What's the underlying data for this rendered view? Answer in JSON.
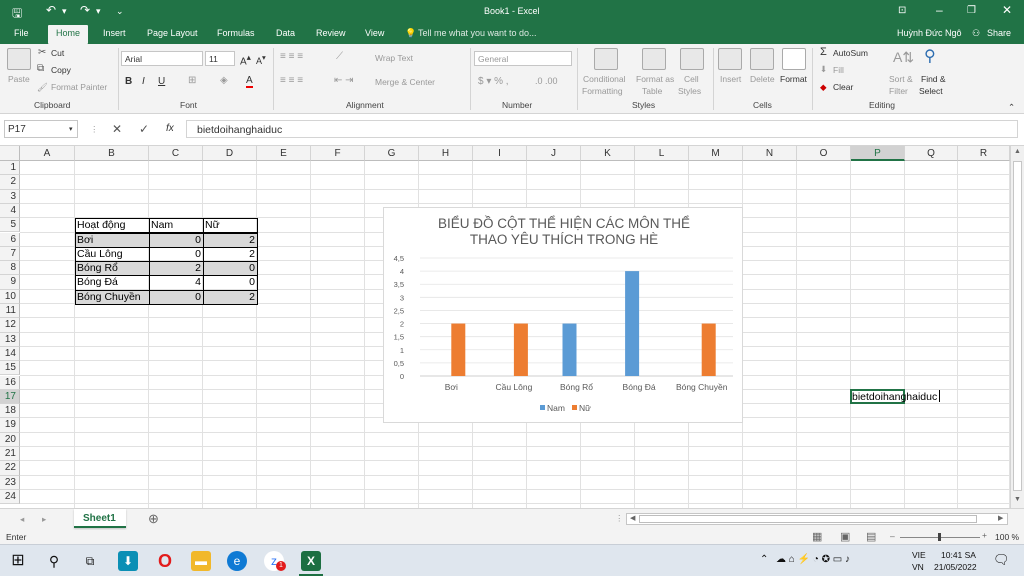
{
  "window": {
    "title": "Book1 - Excel",
    "user": "Huỳnh Đức Ngô",
    "share": "Share",
    "tell_me": "Tell me what you want to do..."
  },
  "menu": [
    "File",
    "Home",
    "Insert",
    "Page Layout",
    "Formulas",
    "Data",
    "Review",
    "View"
  ],
  "ribbon": {
    "clipboard": {
      "paste": "Paste",
      "cut": "Cut",
      "copy": "Copy",
      "format_painter": "Format Painter",
      "label": "Clipboard"
    },
    "font": {
      "name": "Arial",
      "size": "11",
      "bold": "B",
      "italic": "I",
      "underline": "U",
      "label": "Font"
    },
    "alignment": {
      "wrap": "Wrap Text",
      "merge": "Merge & Center",
      "label": "Alignment"
    },
    "number": {
      "format": "General",
      "label": "Number"
    },
    "styles": {
      "conditional1": "Conditional",
      "conditional2": "Formatting",
      "table1": "Format as",
      "table2": "Table",
      "cell1": "Cell",
      "cell2": "Styles",
      "label": "Styles"
    },
    "cells": {
      "insert": "Insert",
      "delete": "Delete",
      "format": "Format",
      "label": "Cells"
    },
    "editing": {
      "autosum": "AutoSum",
      "fill": "Fill",
      "clear": "Clear",
      "sort1": "Sort &",
      "sort2": "Filter",
      "find1": "Find &",
      "find2": "Select",
      "label": "Editing"
    }
  },
  "formula_bar": {
    "name_box": "P17",
    "fx": "fx",
    "value": "bietdoihanghaiduc"
  },
  "columns": [
    "A",
    "B",
    "C",
    "D",
    "E",
    "F",
    "G",
    "H",
    "I",
    "J",
    "K",
    "L",
    "M",
    "N",
    "O",
    "P",
    "Q",
    "R"
  ],
  "rows": [
    "1",
    "2",
    "3",
    "4",
    "5",
    "6",
    "7",
    "8",
    "9",
    "10",
    "11",
    "12",
    "13",
    "14",
    "15",
    "16",
    "17",
    "18",
    "19",
    "20",
    "21",
    "22",
    "23",
    "24"
  ],
  "table": {
    "headers": [
      "Hoạt động",
      "Nam",
      "Nữ"
    ],
    "rows": [
      [
        "Bơi",
        "0",
        "2"
      ],
      [
        "Cầu Lông",
        "0",
        "2"
      ],
      [
        "Bóng Rổ",
        "2",
        "0"
      ],
      [
        "Bóng Đá",
        "4",
        "0"
      ],
      [
        "Bóng Chuyền",
        "0",
        "2"
      ]
    ]
  },
  "active_cell_text": "bietdoihanghaiduc",
  "chart_data": {
    "type": "bar",
    "title_line1": "BIỂU ĐỒ CỘT THỂ HIỆN CÁC MÔN THỂ",
    "title_line2": "THAO YÊU THÍCH TRONG HÈ",
    "categories": [
      "Bơi",
      "Cầu Lông",
      "Bóng Rổ",
      "Bóng Đá",
      "Bóng Chuyền"
    ],
    "series": [
      {
        "name": "Nam",
        "values": [
          0,
          0,
          2,
          4,
          0
        ],
        "color": "#5b9bd5"
      },
      {
        "name": "Nữ",
        "values": [
          2,
          2,
          0,
          0,
          2
        ],
        "color": "#ed7d31"
      }
    ],
    "yticks": [
      "0",
      "0,5",
      "1",
      "1,5",
      "2",
      "2,5",
      "3",
      "3,5",
      "4",
      "4,5"
    ],
    "ylim": [
      0,
      4.5
    ],
    "legend": "bottom",
    "grid": true
  },
  "sheet_tab": "Sheet1",
  "status": {
    "mode": "Enter",
    "zoom": "100 %"
  },
  "taskbar": {
    "lang1": "VIE",
    "lang2": "VN",
    "time": "10:41 SA",
    "date": "21/05/2022",
    "badge": "1"
  }
}
